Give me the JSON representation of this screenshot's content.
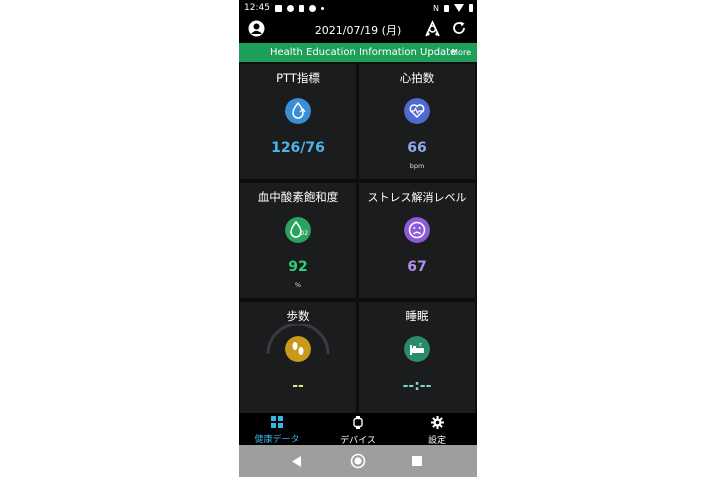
{
  "status_bar": {
    "time": "12:45"
  },
  "header": {
    "date": "2021/07/19 (月)"
  },
  "banner": {
    "message": "Health Education Information Update",
    "more": "More"
  },
  "cards": [
    {
      "title": "PTT指標",
      "value": "126/76",
      "unit": "",
      "icon": "droplet-heart-icon",
      "color": "#4fb3ea",
      "icon_bg": "#3a8fd6"
    },
    {
      "title": "心拍数",
      "value": "66",
      "unit": "bpm",
      "icon": "heart-pulse-icon",
      "color": "#8ea9f0",
      "icon_bg": "#4f6bd1"
    },
    {
      "title": "血中酸素飽和度",
      "value": "92",
      "unit": "%",
      "icon": "oxygen-drop-icon",
      "color": "#2ed07a",
      "icon_bg": "#2aa35f"
    },
    {
      "title": "ストレス解消レベル",
      "value": "67",
      "unit": "",
      "icon": "sad-face-icon",
      "color": "#b48ef0",
      "icon_bg": "#8d5bd8"
    },
    {
      "title": "歩数",
      "value": "--",
      "unit": "",
      "icon": "footprints-icon",
      "color": "#e8e08a",
      "icon_bg": "#c99a1a"
    },
    {
      "title": "睡眠",
      "value": "--:--",
      "unit": "",
      "icon": "bed-icon",
      "color": "#7ed6c8",
      "icon_bg": "#2a8a6c"
    }
  ],
  "bottom_nav": [
    {
      "label": "健康データ",
      "icon": "grid-icon",
      "active": true
    },
    {
      "label": "デバイス",
      "icon": "watch-icon",
      "active": false
    },
    {
      "label": "設定",
      "icon": "gear-icon",
      "active": false
    }
  ],
  "colors": {
    "banner": "#1ea05a",
    "active_tab": "#33b5e5"
  }
}
